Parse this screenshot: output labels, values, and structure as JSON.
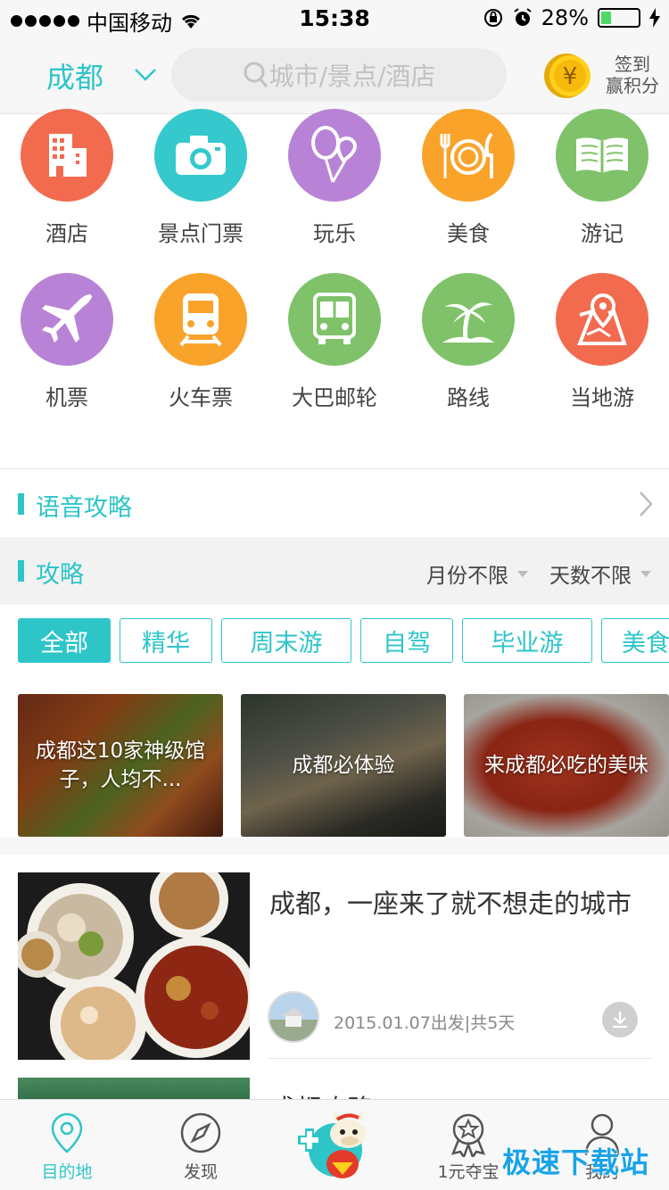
{
  "status_bar": {
    "carrier": "中国移动",
    "time": "15:38",
    "battery_percent": 28,
    "battery_label": "28%"
  },
  "header": {
    "city": "成都",
    "search_placeholder": "城市/景点/酒店",
    "sign_in_line1": "签到",
    "sign_in_line2": "赢积分",
    "coin_symbol": "¥"
  },
  "categories": [
    {
      "label": "酒店",
      "icon": "hotel-icon",
      "color": "#f26b4f"
    },
    {
      "label": "景点门票",
      "icon": "camera-icon",
      "color": "#35c8cc"
    },
    {
      "label": "玩乐",
      "icon": "balloon-icon",
      "color": "#b883d6"
    },
    {
      "label": "美食",
      "icon": "dining-icon",
      "color": "#f9a32b"
    },
    {
      "label": "游记",
      "icon": "book-icon",
      "color": "#7fc269"
    },
    {
      "label": "机票",
      "icon": "plane-icon",
      "color": "#b883d6"
    },
    {
      "label": "火车票",
      "icon": "train-icon",
      "color": "#f9a32b"
    },
    {
      "label": "大巴邮轮",
      "icon": "bus-icon",
      "color": "#7fc269"
    },
    {
      "label": "路线",
      "icon": "palm-tree-icon",
      "color": "#7fc269"
    },
    {
      "label": "当地游",
      "icon": "map-pin-icon",
      "color": "#f26b4f"
    }
  ],
  "pager": {
    "pages": 2,
    "active": 0
  },
  "voice_guide": {
    "title": "语音攻略"
  },
  "guide": {
    "title": "攻略",
    "filter_month": "月份不限",
    "filter_days": "天数不限"
  },
  "tags": [
    "全部",
    "精华",
    "周末游",
    "自驾",
    "毕业游",
    "美食"
  ],
  "active_tag": 0,
  "cards": [
    {
      "title": "成都这10家神级馆子，人均不..."
    },
    {
      "title": "成都必体验"
    },
    {
      "title": "来成都必吃的美味"
    }
  ],
  "article": {
    "title": "成都，一座来了就不想走的城市",
    "meta": "2015.01.07出发|共5天"
  },
  "article2": {
    "title": "成都攻略"
  },
  "tabbar": [
    {
      "label": "目的地",
      "icon": "location-pin-icon",
      "active": true
    },
    {
      "label": "发现",
      "icon": "compass-icon",
      "active": false
    },
    {
      "label": "",
      "icon": "mascot-icon",
      "active": false
    },
    {
      "label": "1元夺宝",
      "icon": "award-star-icon",
      "active": false
    },
    {
      "label": "我的",
      "icon": "user-icon",
      "active": false
    }
  ],
  "watermark": "极速下载站",
  "colors": {
    "accent": "#2ec5c9"
  }
}
